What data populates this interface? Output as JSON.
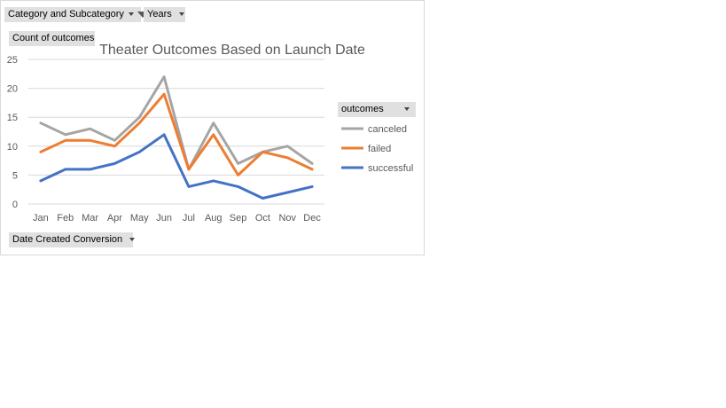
{
  "filters": {
    "category": "Category and Subcategory",
    "years": "Years",
    "values_field": "Count of outcomes",
    "axis_field": "Date Created Conversion",
    "legend_field": "outcomes"
  },
  "colors": {
    "canceled": "#a5a5a5",
    "failed": "#ed7d31",
    "successful": "#4472c4",
    "grid": "#d9d9d9",
    "text": "#595959"
  },
  "chart_data": {
    "type": "line",
    "title": "Theater Outcomes Based on Launch Date",
    "xlabel": "",
    "ylabel": "",
    "categories": [
      "Jan",
      "Feb",
      "Mar",
      "Apr",
      "May",
      "Jun",
      "Jul",
      "Aug",
      "Sep",
      "Oct",
      "Nov",
      "Dec"
    ],
    "ylim": [
      0,
      25
    ],
    "yticks": [
      "0",
      "5",
      "10",
      "15",
      "20",
      "25"
    ],
    "grid": true,
    "legend_position": "right",
    "series": [
      {
        "name": "canceled",
        "color": "#a5a5a5",
        "values": [
          14,
          12,
          13,
          11,
          15,
          22,
          6,
          14,
          7,
          9,
          10,
          7
        ]
      },
      {
        "name": "failed",
        "color": "#ed7d31",
        "values": [
          9,
          11,
          11,
          10,
          14,
          19,
          6,
          12,
          5,
          9,
          8,
          6
        ]
      },
      {
        "name": "successful",
        "color": "#4472c4",
        "values": [
          4,
          6,
          6,
          7,
          9,
          12,
          3,
          4,
          3,
          1,
          2,
          3
        ]
      }
    ]
  }
}
